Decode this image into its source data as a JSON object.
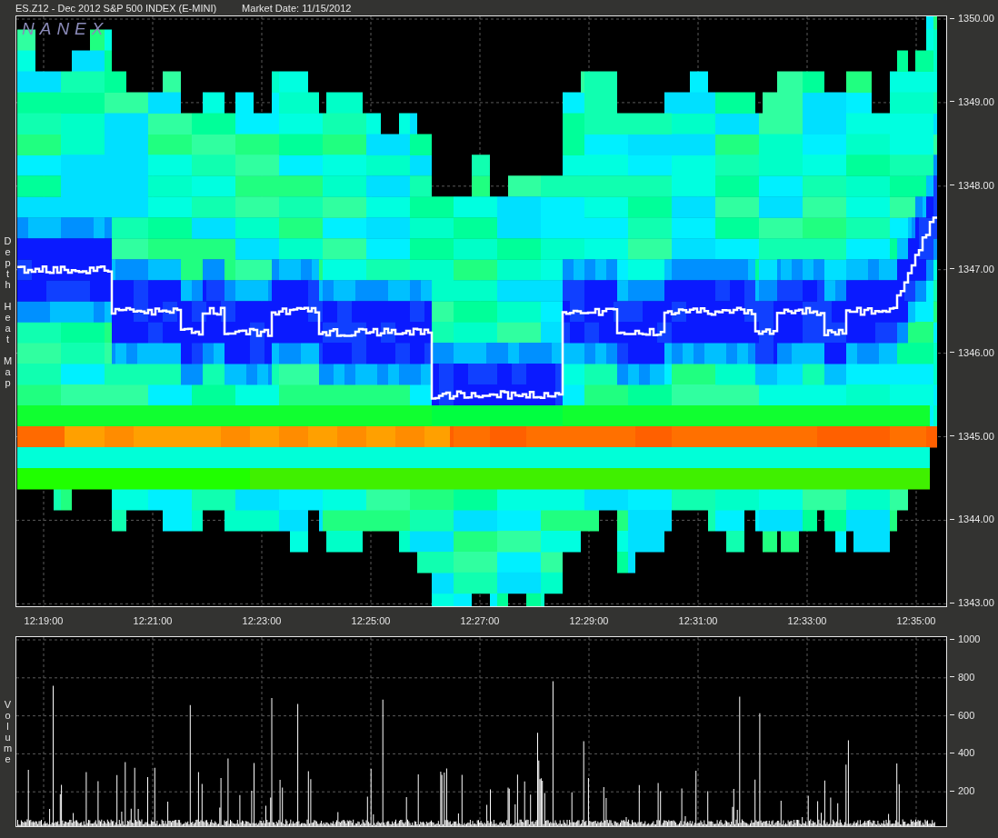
{
  "header": {
    "symbol": "ES.Z12 - Dec 2012 S&P 500 INDEX (E-MINI)",
    "market_date": "Market Date: 11/15/2012"
  },
  "heatmap": {
    "logo": "NANEX",
    "side_label": "Depth Heat Map",
    "price_ticks": [
      "1350.00",
      "1349.00",
      "1348.00",
      "1347.00",
      "1346.00",
      "1345.00",
      "1344.00",
      "1343.00"
    ],
    "time_ticks": [
      "12:19:00",
      "12:21:00",
      "12:23:00",
      "12:25:00",
      "12:27:00",
      "12:29:00",
      "12:31:00",
      "12:33:00",
      "12:35:00"
    ]
  },
  "volume": {
    "side_label": "Volume",
    "ticks": [
      "1000",
      "800",
      "600",
      "400",
      "200"
    ]
  }
}
